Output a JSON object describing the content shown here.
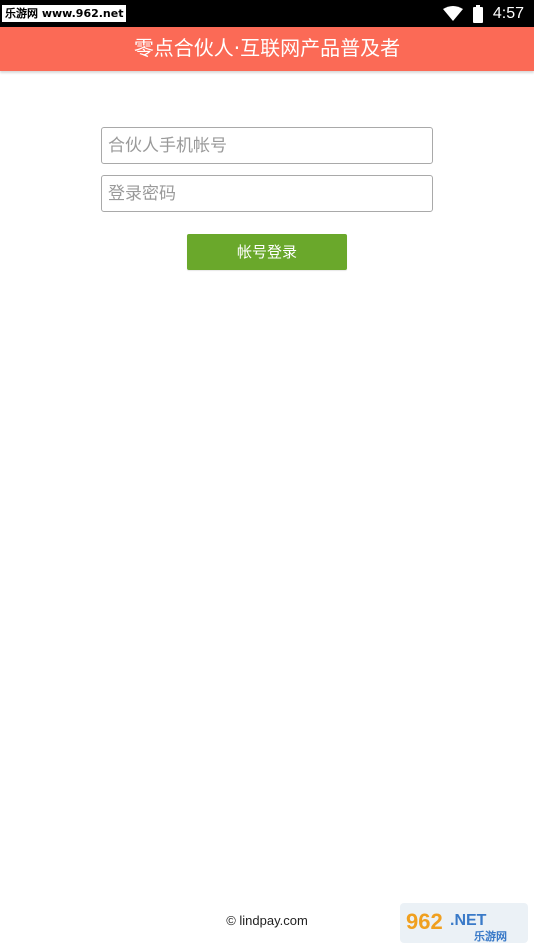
{
  "status_bar": {
    "watermark": "乐游网 www.962.net",
    "time": "4:57",
    "icons": [
      "wifi-icon",
      "battery-icon"
    ]
  },
  "header": {
    "title": "零点合伙人·互联网产品普及者"
  },
  "form": {
    "phone_placeholder": "合伙人手机帐号",
    "password_placeholder": "登录密码",
    "login_label": "帐号登录"
  },
  "footer": {
    "copyright": "© lindpay.com"
  },
  "watermark_bottom": {
    "number": "962",
    "suffix": ".NET",
    "cn": "乐游网"
  },
  "colors": {
    "header": "#fb6a56",
    "button": "#6aa82b"
  }
}
